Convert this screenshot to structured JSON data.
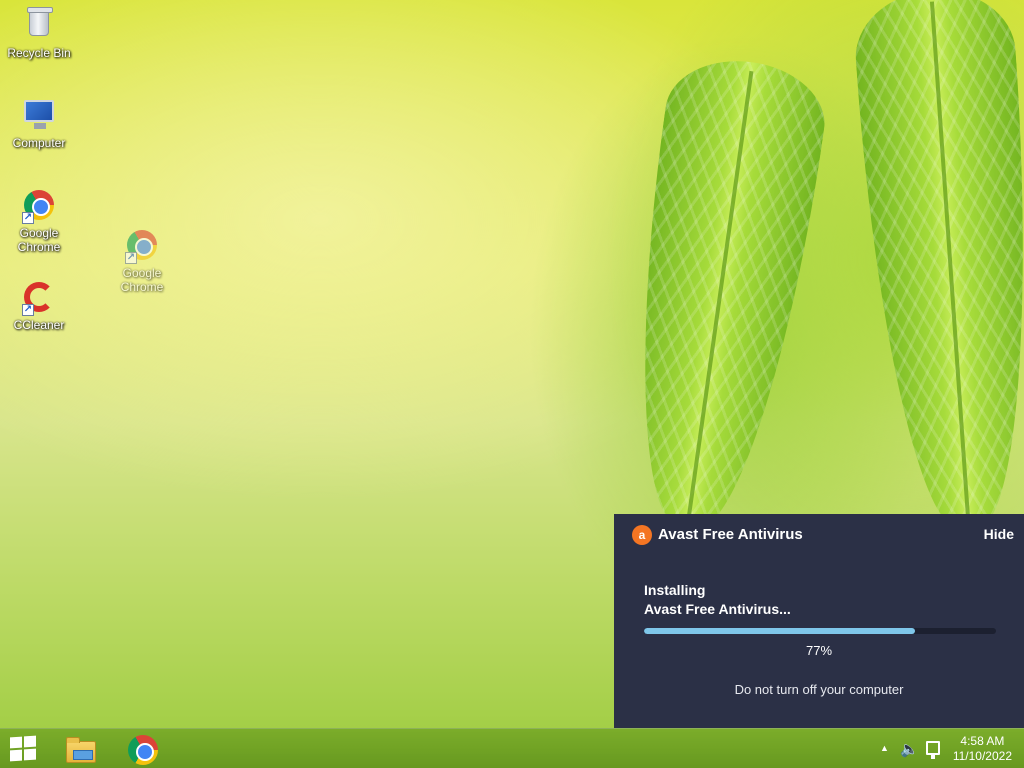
{
  "desktop": {
    "icons": [
      {
        "label": "Recycle Bin",
        "icon": "recycle-bin-icon"
      },
      {
        "label": "Computer",
        "icon": "computer-icon"
      },
      {
        "label": "Google Chrome",
        "icon": "chrome-icon"
      },
      {
        "label": "CCleaner",
        "icon": "ccleaner-icon"
      },
      {
        "label": "Google Chrome",
        "icon": "chrome-icon"
      }
    ]
  },
  "avast": {
    "title": "Avast Free Antivirus",
    "hide_label": "Hide",
    "status_line1": "Installing",
    "status_line2": "Avast Free Antivirus...",
    "progress_fraction": 0.77,
    "percent_text": "77%",
    "warning": "Do not turn off your computer",
    "logo_glyph": "a",
    "colors": {
      "panel": "#2b3046",
      "accent": "#f47523",
      "progress": "#7fc7ea"
    }
  },
  "taskbar": {
    "pinned": [
      {
        "name": "File Explorer",
        "icon": "folder-icon"
      },
      {
        "name": "Google Chrome",
        "icon": "chrome-icon"
      }
    ],
    "tray": {
      "arrow_glyph": "▲",
      "volume_glyph": "🔈",
      "time": "4:58 AM",
      "date": "11/10/2022"
    }
  }
}
